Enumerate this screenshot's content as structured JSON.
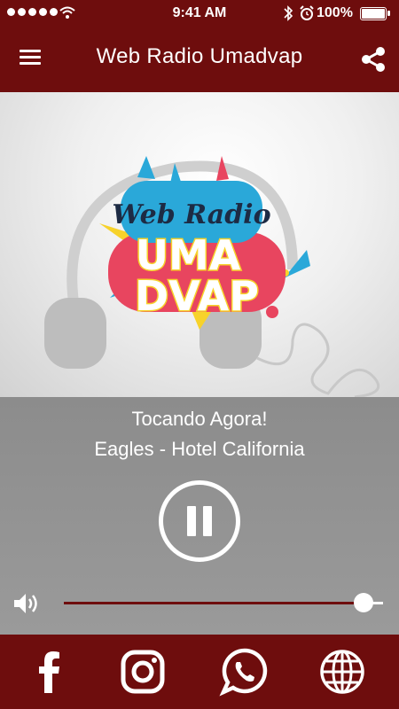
{
  "status_bar": {
    "time": "9:41 AM",
    "battery": "100%",
    "icons": [
      "signal-dots-icon",
      "wifi-icon",
      "bluetooth-icon",
      "alarm-icon",
      "battery-icon"
    ]
  },
  "header": {
    "title": "Web Radio Umadvap",
    "icons": [
      "hamburger-menu-icon",
      "share-icon"
    ]
  },
  "logo": {
    "line1": "Web Radio",
    "line2": "UMA",
    "line3": "DVAP"
  },
  "player": {
    "now_playing_label": "Tocando Agora!",
    "track": "Eagles - Hotel California",
    "state_icon": "pause-icon",
    "volume": 0.94
  },
  "footer": {
    "icons": [
      "facebook-icon",
      "instagram-icon",
      "whatsapp-icon",
      "globe-icon"
    ]
  },
  "colors": {
    "brand": "#6e0d0d",
    "player_bg": "#8c8c8c",
    "logo_blue": "#2aa8d9",
    "logo_pink": "#e8455f",
    "logo_yellow": "#f7d22a"
  }
}
